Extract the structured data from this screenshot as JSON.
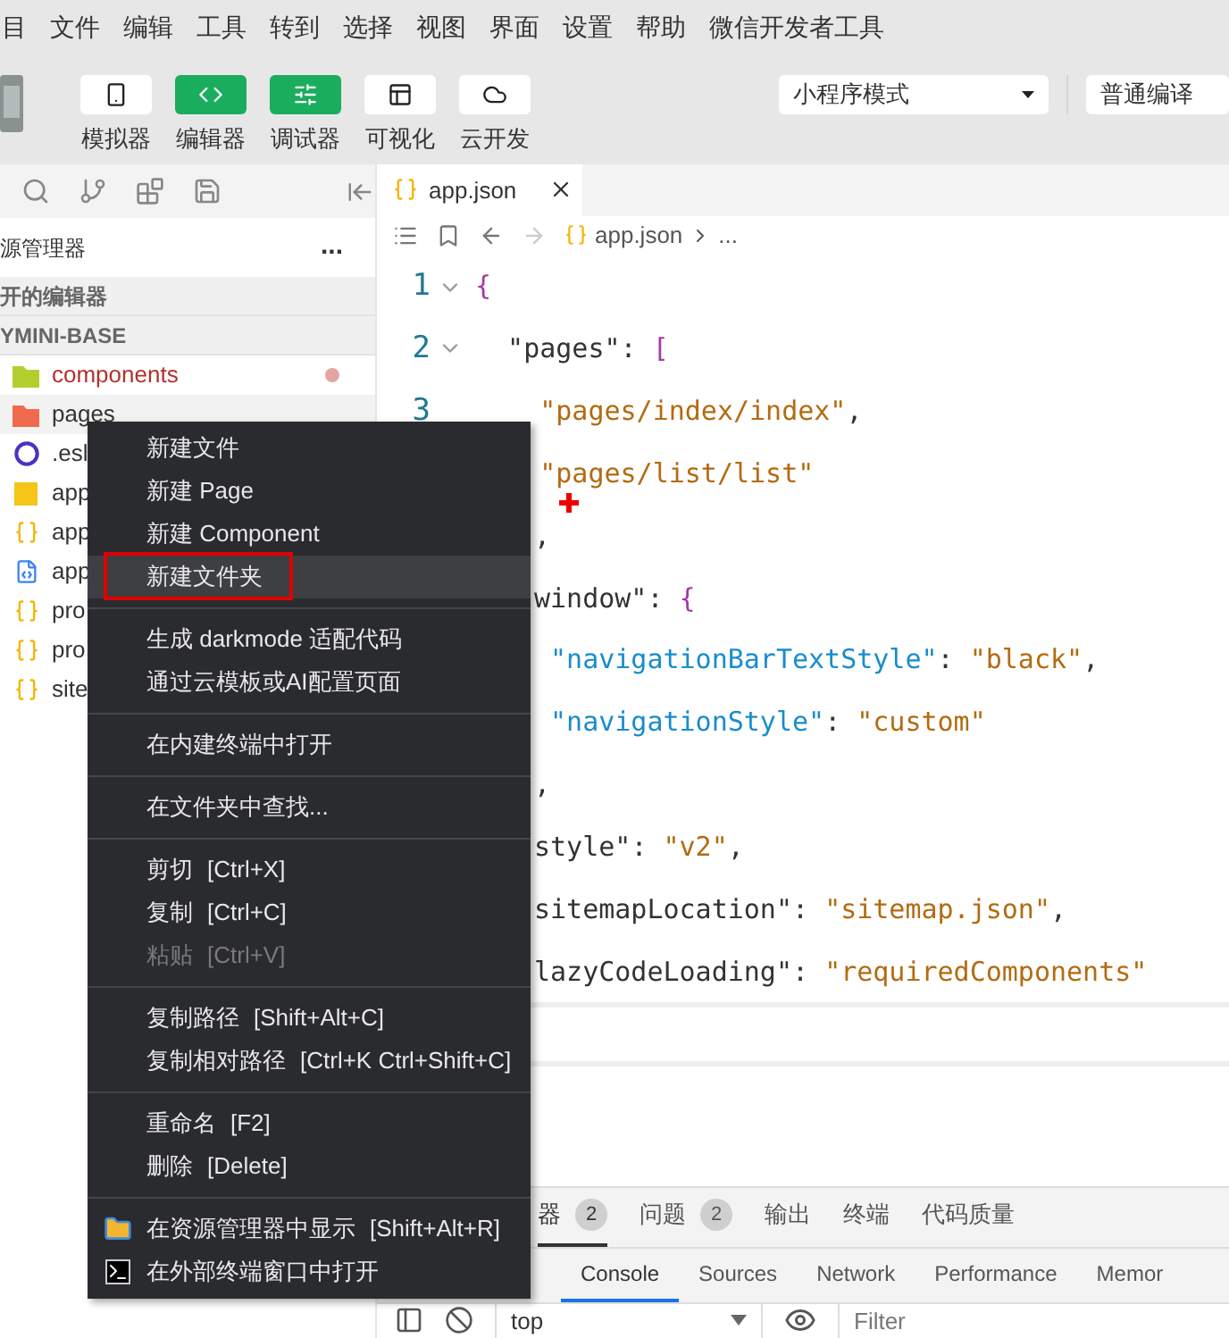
{
  "menu_bar": [
    "目",
    "文件",
    "编辑",
    "工具",
    "转到",
    "选择",
    "视图",
    "界面",
    "设置",
    "帮助",
    "微信开发者工具"
  ],
  "toolbar": {
    "buttons": [
      {
        "label": "模拟器",
        "kind": "phone",
        "selected": false
      },
      {
        "label": "编辑器",
        "kind": "code",
        "selected": true
      },
      {
        "label": "调试器",
        "kind": "sliders",
        "selected": true
      },
      {
        "label": "可视化",
        "kind": "layout",
        "selected": false
      },
      {
        "label": "云开发",
        "kind": "cloud",
        "selected": false
      }
    ],
    "mode_select": "小程序模式",
    "compile_select": "普通编译"
  },
  "sidebar": {
    "title": "源管理器",
    "more": "...",
    "sections": [
      "开的编辑器",
      "YMINI-BASE"
    ],
    "files": [
      {
        "name": "components",
        "kind": "folder",
        "color": "#b3cf2e",
        "modified": true,
        "selected": false
      },
      {
        "name": "pages",
        "kind": "folder",
        "color": "#f06a4e",
        "modified": false,
        "selected": true
      },
      {
        "name": ".esl",
        "kind": "eslint",
        "color": "#4b32c3",
        "modified": false,
        "selected": false
      },
      {
        "name": "app",
        "kind": "js",
        "color": "#f5c518",
        "modified": false,
        "selected": false
      },
      {
        "name": "app",
        "kind": "json",
        "color": "#f5b400",
        "modified": false,
        "selected": false
      },
      {
        "name": "app",
        "kind": "css",
        "color": "#3b82f6",
        "modified": false,
        "selected": false
      },
      {
        "name": "pro",
        "kind": "json",
        "color": "#f5b400",
        "modified": false,
        "selected": false
      },
      {
        "name": "pro",
        "kind": "json",
        "color": "#f5b400",
        "modified": false,
        "selected": false
      },
      {
        "name": "site",
        "kind": "json",
        "color": "#f5b400",
        "modified": false,
        "selected": false
      }
    ]
  },
  "editor": {
    "tab": "app.json",
    "breadcrumb": [
      "app.json",
      "..."
    ],
    "lines": [
      {
        "number": "1",
        "kind": "full",
        "fold": true,
        "segments": [
          {
            "text": "{",
            "kind": "bracket"
          }
        ]
      },
      {
        "number": "2",
        "kind": "full",
        "fold": true,
        "segments": [
          {
            "text": "  \"pages\"",
            "kind": "key"
          },
          {
            "text": ": ",
            "kind": "punct"
          },
          {
            "text": "[",
            "kind": "bracket"
          }
        ]
      },
      {
        "number": "3",
        "kind": "full",
        "fold": false,
        "segments": [
          {
            "text": "    \"pages/index/index\"",
            "kind": "string"
          },
          {
            "text": ",",
            "kind": "punct"
          }
        ]
      },
      {
        "kind": "full",
        "fold": false,
        "segments": [
          {
            "text": "    \"pages/list/list\"",
            "kind": "string"
          }
        ]
      },
      {
        "kind": "clipped",
        "fold": false,
        "segments": [
          {
            "text": ",",
            "kind": "punct"
          }
        ]
      },
      {
        "kind": "clipped",
        "fold": false,
        "segments": [
          {
            "text": "window\"",
            "kind": "key"
          },
          {
            "text": ": ",
            "kind": "punct"
          },
          {
            "text": "{",
            "kind": "bracket"
          }
        ]
      },
      {
        "kind": "clipped",
        "fold": false,
        "segments": [
          {
            "text": " \"navigationBarTextStyle\"",
            "kind": "subkey"
          },
          {
            "text": ": ",
            "kind": "punct"
          },
          {
            "text": "\"black\"",
            "kind": "string"
          },
          {
            "text": ",",
            "kind": "punct"
          }
        ]
      },
      {
        "kind": "clipped",
        "fold": false,
        "segments": [
          {
            "text": " \"navigationStyle\"",
            "kind": "subkey"
          },
          {
            "text": ": ",
            "kind": "punct"
          },
          {
            "text": "\"custom\"",
            "kind": "string"
          }
        ]
      },
      {
        "kind": "clipped",
        "fold": false,
        "segments": [
          {
            "text": ",",
            "kind": "punct"
          }
        ]
      },
      {
        "kind": "clipped",
        "fold": false,
        "segments": [
          {
            "text": "style\"",
            "kind": "key"
          },
          {
            "text": ": ",
            "kind": "punct"
          },
          {
            "text": "\"v2\"",
            "kind": "string"
          },
          {
            "text": ",",
            "kind": "punct"
          }
        ]
      },
      {
        "kind": "clipped",
        "fold": false,
        "segments": [
          {
            "text": "sitemapLocation\"",
            "kind": "key"
          },
          {
            "text": ": ",
            "kind": "punct"
          },
          {
            "text": "\"sitemap.json\"",
            "kind": "string"
          },
          {
            "text": ",",
            "kind": "punct"
          }
        ]
      },
      {
        "kind": "clipped",
        "fold": false,
        "segments": [
          {
            "text": "lazyCodeLoading\"",
            "kind": "key"
          },
          {
            "text": ": ",
            "kind": "punct"
          },
          {
            "text": "\"requiredComponents\"",
            "kind": "string"
          }
        ]
      }
    ]
  },
  "context_menu": {
    "groups": [
      [
        {
          "label": "新建文件",
          "selected": false,
          "disabled": false,
          "annotated": false
        },
        {
          "label": "新建 Page",
          "selected": false,
          "disabled": false,
          "annotated": false
        },
        {
          "label": "新建 Component",
          "selected": false,
          "disabled": false,
          "annotated": false
        },
        {
          "label": "新建文件夹",
          "selected": true,
          "disabled": false,
          "annotated": true
        }
      ],
      [
        {
          "label": "生成 darkmode 适配代码",
          "selected": false,
          "disabled": false,
          "annotated": false
        },
        {
          "label": "通过云模板或AI配置页面",
          "selected": false,
          "disabled": false,
          "annotated": false
        }
      ],
      [
        {
          "label": "在内建终端中打开",
          "selected": false,
          "disabled": false,
          "annotated": false
        }
      ],
      [
        {
          "label": "在文件夹中查找...",
          "selected": false,
          "disabled": false,
          "annotated": false
        }
      ],
      [
        {
          "label": "剪切",
          "shortcut": "[Ctrl+X]",
          "selected": false,
          "disabled": false,
          "annotated": false
        },
        {
          "label": "复制",
          "shortcut": "[Ctrl+C]",
          "selected": false,
          "disabled": false,
          "annotated": false
        },
        {
          "label": "粘贴",
          "shortcut": "[Ctrl+V]",
          "selected": false,
          "disabled": true,
          "annotated": false
        }
      ],
      [
        {
          "label": "复制路径",
          "shortcut": "[Shift+Alt+C]",
          "selected": false,
          "disabled": false,
          "annotated": false
        },
        {
          "label": "复制相对路径",
          "shortcut": "[Ctrl+K Ctrl+Shift+C]",
          "selected": false,
          "disabled": false,
          "annotated": false
        }
      ],
      [
        {
          "label": "重命名",
          "shortcut": "[F2]",
          "selected": false,
          "disabled": false,
          "annotated": false
        },
        {
          "label": "删除",
          "shortcut": "[Delete]",
          "selected": false,
          "disabled": false,
          "annotated": false
        }
      ],
      [
        {
          "label": "在资源管理器中显示",
          "shortcut": "[Shift+Alt+R]",
          "kind": "folder",
          "selected": false,
          "disabled": false,
          "annotated": false
        },
        {
          "label": "在外部终端窗口中打开",
          "kind": "terminal",
          "selected": false,
          "disabled": false,
          "annotated": false
        }
      ]
    ]
  },
  "bottom_panel": {
    "tabs": [
      {
        "label": "器",
        "count": "2",
        "selected": true
      },
      {
        "label": "问题",
        "count": "2",
        "selected": false
      },
      {
        "label": "输出",
        "selected": false
      },
      {
        "label": "终端",
        "selected": false
      },
      {
        "label": "代码质量",
        "selected": false
      }
    ],
    "devtools_tabs": [
      {
        "label": "Console",
        "selected": true
      },
      {
        "label": "Sources",
        "selected": false
      },
      {
        "label": "Network",
        "selected": false
      },
      {
        "label": "Performance",
        "selected": false
      },
      {
        "label": "Memor",
        "selected": false
      }
    ],
    "context": "top",
    "filter_placeholder": "Filter"
  }
}
